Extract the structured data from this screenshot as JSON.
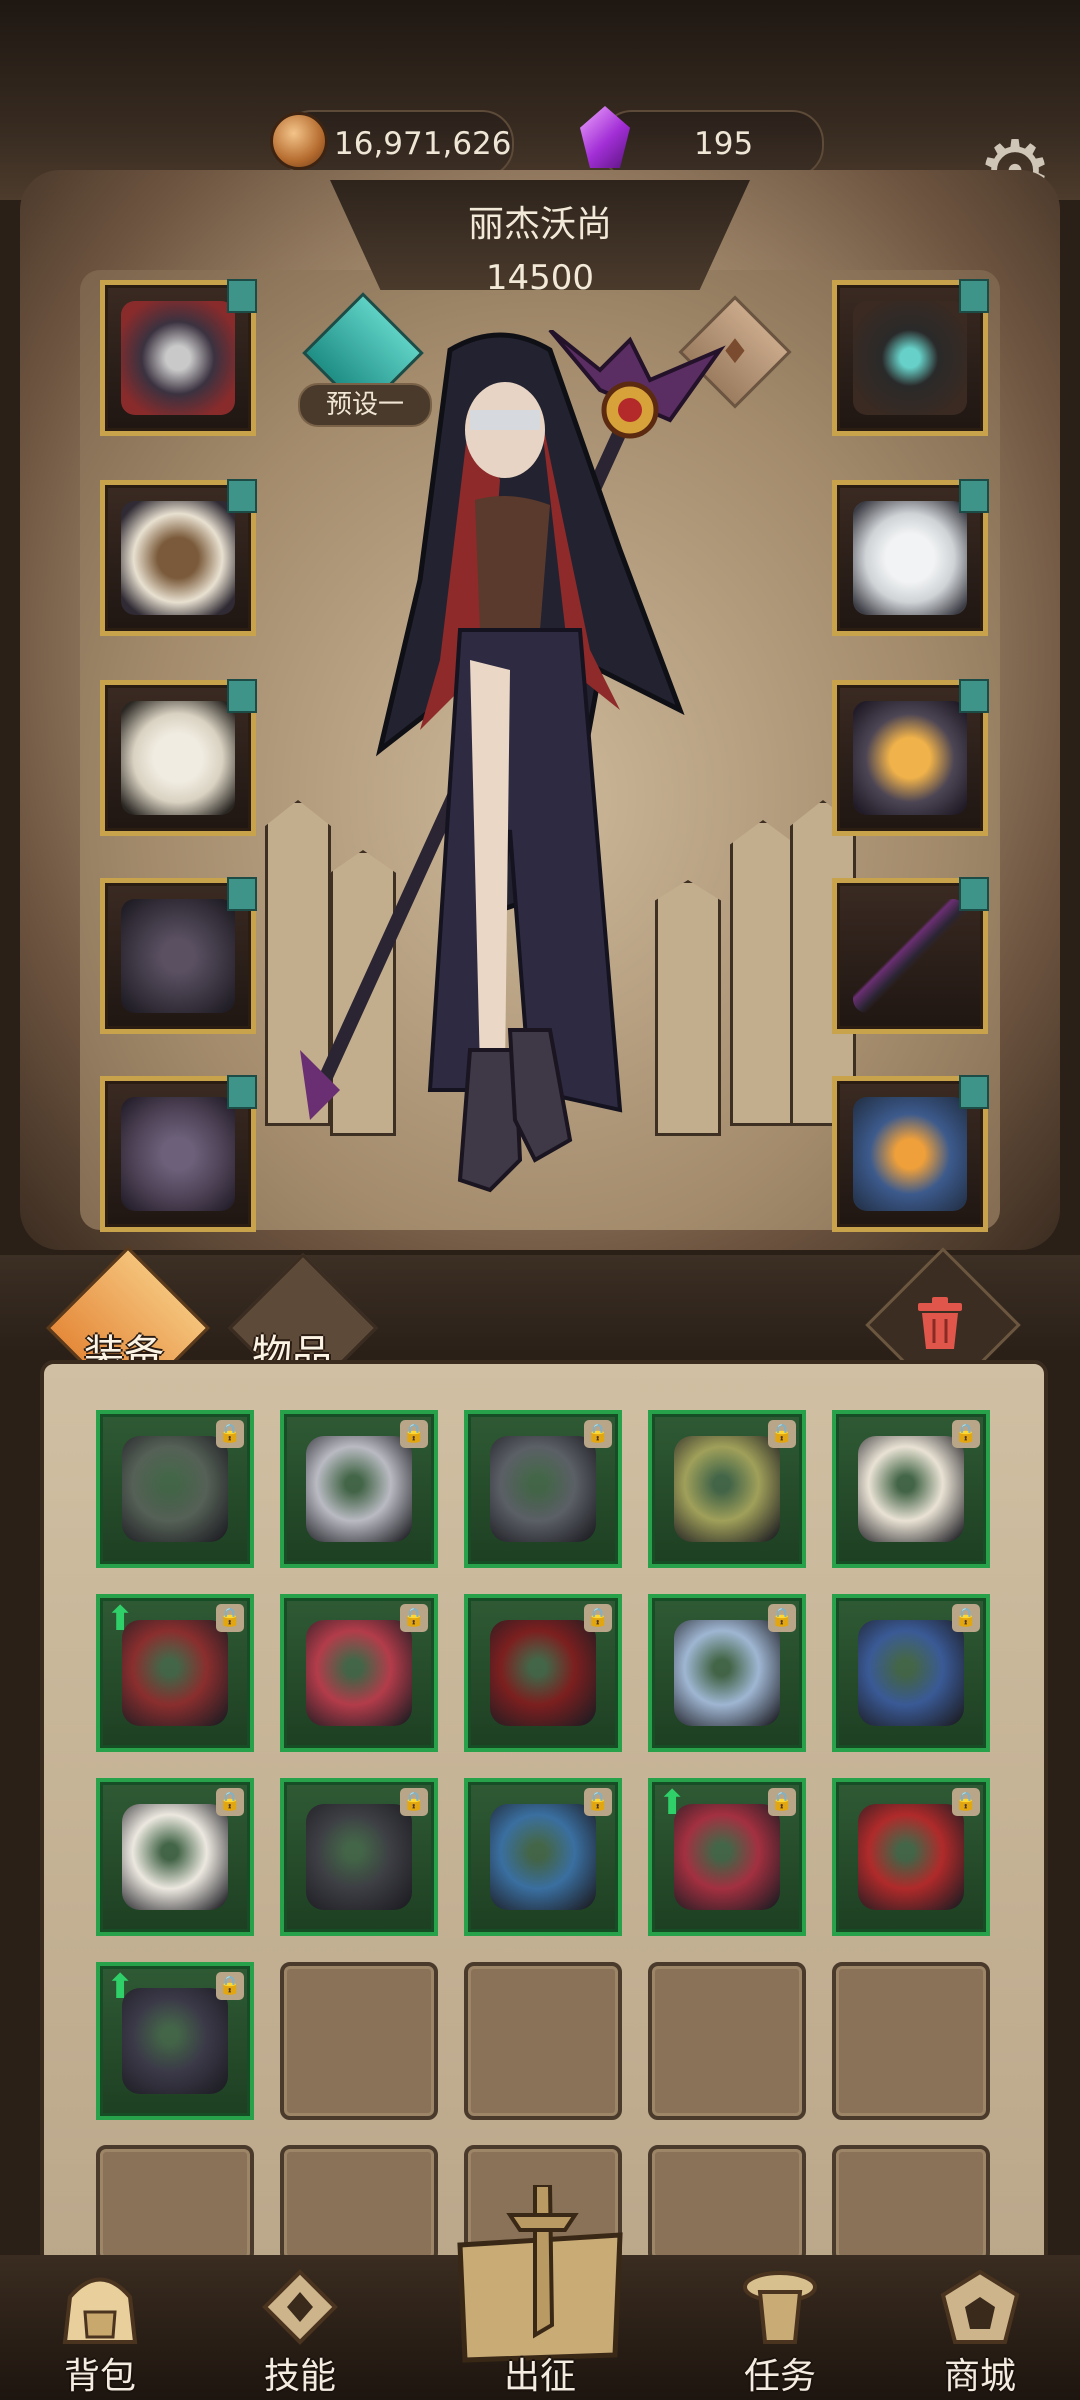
{
  "currencies": {
    "gold": {
      "value": "16,971,626",
      "icon": "gold-coin-icon"
    },
    "gems": {
      "value": "195",
      "icon": "purple-crystal-icon"
    }
  },
  "settings": {
    "icon": "gear-icon"
  },
  "hero": {
    "name": "丽杰沃尚",
    "power": "14500",
    "preset_label": "预设一"
  },
  "equipment_left": [
    {
      "name": "hood-helmet",
      "icon": "hood-icon",
      "color": "#8a2b2b"
    },
    {
      "name": "armor",
      "icon": "armor-icon",
      "color": "#7a5a3a"
    },
    {
      "name": "gloves",
      "icon": "gloves-icon",
      "color": "#d9d2c2"
    },
    {
      "name": "pants",
      "icon": "pants-icon",
      "color": "#3a3440"
    },
    {
      "name": "boots",
      "icon": "boots-icon",
      "color": "#4a3f52"
    }
  ],
  "equipment_right": [
    {
      "name": "necklace",
      "icon": "moon-necklace-icon",
      "color": "#3aa6a0"
    },
    {
      "name": "shoulder",
      "icon": "feather-shoulder-icon",
      "color": "#cfd3d6"
    },
    {
      "name": "ring",
      "icon": "ring-icon",
      "color": "#e0a044"
    },
    {
      "name": "staff",
      "icon": "staff-icon",
      "color": "#6a2f73"
    },
    {
      "name": "tome",
      "icon": "tome-icon",
      "color": "#3c5a8c"
    }
  ],
  "tabs": {
    "equipment": "装备",
    "items": "物品"
  },
  "trash": {
    "icon": "trash-icon"
  },
  "inventory": [
    {
      "icon": "pants-icon",
      "color": "#556056",
      "upgrade": false,
      "locked": true
    },
    {
      "icon": "gloves-icon",
      "color": "#b9bac2",
      "upgrade": false,
      "locked": true
    },
    {
      "icon": "ring-icon",
      "color": "#5b5f66",
      "upgrade": false,
      "locked": true
    },
    {
      "icon": "shoulder-icon",
      "color": "#a0a05a",
      "upgrade": false,
      "locked": true
    },
    {
      "icon": "moon-ring-icon",
      "color": "#e9e2d4",
      "upgrade": false,
      "locked": true
    },
    {
      "icon": "armor-icon",
      "color": "#8a2e2e",
      "upgrade": true,
      "locked": true
    },
    {
      "icon": "heels-icon",
      "color": "#b33c4a",
      "upgrade": false,
      "locked": true
    },
    {
      "icon": "ring-icon",
      "color": "#7c1f1f",
      "upgrade": false,
      "locked": true
    },
    {
      "icon": "helmet-icon",
      "color": "#9fb6d2",
      "upgrade": false,
      "locked": true
    },
    {
      "icon": "boots-icon",
      "color": "#3a5a96",
      "upgrade": false,
      "locked": true
    },
    {
      "icon": "gloves-icon",
      "color": "#ece8e0",
      "upgrade": false,
      "locked": true
    },
    {
      "icon": "gauntlet-icon",
      "color": "#3d3e44",
      "upgrade": false,
      "locked": true
    },
    {
      "icon": "crystal-glove-icon",
      "color": "#3a6fa0",
      "upgrade": false,
      "locked": true
    },
    {
      "icon": "robe-icon",
      "color": "#a33040",
      "upgrade": true,
      "locked": true
    },
    {
      "icon": "hood-icon",
      "color": "#b02a2a",
      "upgrade": false,
      "locked": true
    },
    {
      "icon": "pants-icon",
      "color": "#3b3948",
      "upgrade": true,
      "locked": true
    }
  ],
  "nav": {
    "backpack": {
      "label": "背包",
      "icon": "backpack-icon"
    },
    "skills": {
      "label": "技能",
      "icon": "skills-icon"
    },
    "battle": {
      "label": "出征",
      "icon": "battle-map-icon"
    },
    "quests": {
      "label": "任务",
      "icon": "quest-scroll-icon"
    },
    "shop": {
      "label": "商城",
      "icon": "shop-icon"
    }
  }
}
